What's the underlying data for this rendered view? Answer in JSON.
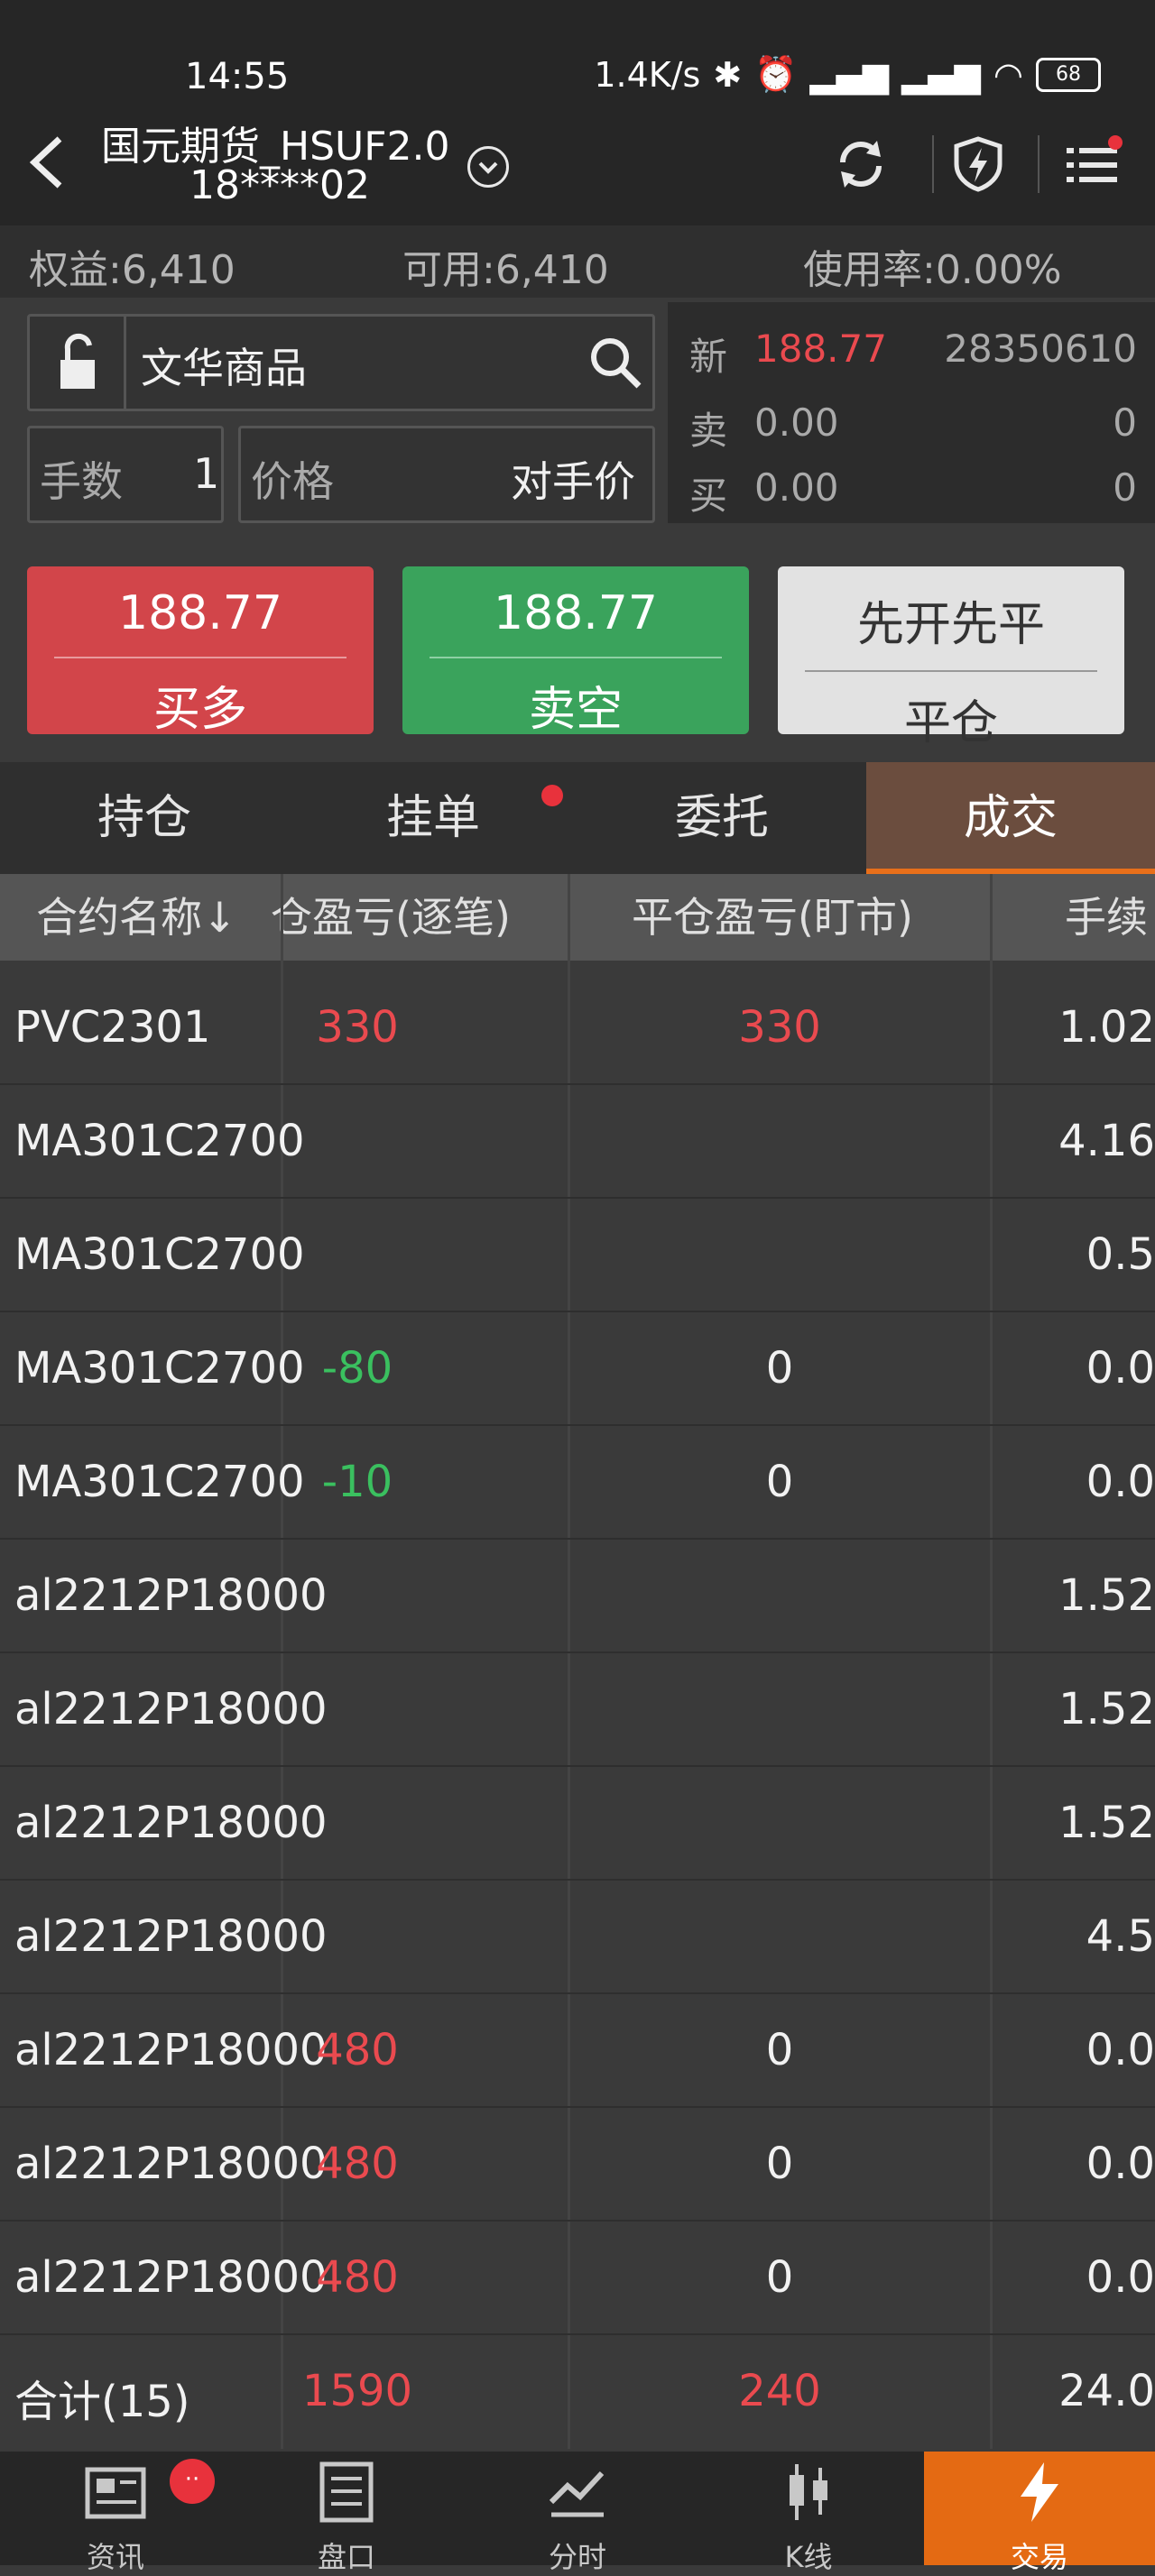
{
  "status_bar": {
    "time": "14:55",
    "speed": "1.4K/s",
    "battery": "68"
  },
  "header": {
    "title_line1": "国元期货_HSUF2.0",
    "title_line2": "18****02"
  },
  "summary": {
    "equity": "权益:6,410",
    "available": "可用:6,410",
    "usage": "使用率:0.00%"
  },
  "order": {
    "contract_name": "文华商品",
    "qty_label": "手数",
    "qty_value": "1",
    "price_label": "价格",
    "price_type": "对手价"
  },
  "quote": {
    "new_label": "新",
    "new_price": "188.77",
    "new_volume": "28350610",
    "sell_label": "卖",
    "sell_price": "0.00",
    "sell_volume": "0",
    "buy_label": "买",
    "buy_price": "0.00",
    "buy_volume": "0"
  },
  "buttons": {
    "buy_price": "188.77",
    "buy_label": "买多",
    "sell_price": "188.77",
    "sell_label": "卖空",
    "close_mode": "先开先平",
    "close_label": "平仓"
  },
  "tabs": [
    "持仓",
    "挂单",
    "委托",
    "成交"
  ],
  "table": {
    "headers": [
      "合约名称↓",
      "仓盈亏(逐笔)",
      "平仓盈亏(盯市)",
      "手续"
    ],
    "rows": [
      {
        "name": "PVC2301",
        "pnl_trade": "330",
        "pnl_mark": "330",
        "fee": "1.02"
      },
      {
        "name": "MA301C2700",
        "pnl_trade": "",
        "pnl_mark": "",
        "fee": "4.16"
      },
      {
        "name": "MA301C2700",
        "pnl_trade": "",
        "pnl_mark": "",
        "fee": "0.5"
      },
      {
        "name": "MA301C2700",
        "pnl_trade": "-80",
        "pnl_mark": "0",
        "fee": "0.0"
      },
      {
        "name": "MA301C2700",
        "pnl_trade": "-10",
        "pnl_mark": "0",
        "fee": "0.0"
      },
      {
        "name": "al2212P18000",
        "pnl_trade": "",
        "pnl_mark": "",
        "fee": "1.52"
      },
      {
        "name": "al2212P18000",
        "pnl_trade": "",
        "pnl_mark": "",
        "fee": "1.52"
      },
      {
        "name": "al2212P18000",
        "pnl_trade": "",
        "pnl_mark": "",
        "fee": "1.52"
      },
      {
        "name": "al2212P18000",
        "pnl_trade": "",
        "pnl_mark": "",
        "fee": "4.5"
      },
      {
        "name": "al2212P18000",
        "pnl_trade": "480",
        "pnl_mark": "0",
        "fee": "0.0"
      },
      {
        "name": "al2212P18000",
        "pnl_trade": "480",
        "pnl_mark": "0",
        "fee": "0.0"
      },
      {
        "name": "al2212P18000",
        "pnl_trade": "480",
        "pnl_mark": "0",
        "fee": "0.0"
      },
      {
        "name": "合计(15)",
        "pnl_trade": "1590",
        "pnl_mark": "240",
        "fee": "24.0"
      }
    ]
  },
  "nav": {
    "items": [
      "资讯",
      "盘口",
      "分时",
      "K线",
      "交易"
    ],
    "badge": "··"
  },
  "colors": {
    "buy": "#d2454a",
    "sell": "#3aa35c",
    "accent": "#e46a13",
    "profit": "#ea4a4f",
    "loss": "#3ac05f"
  }
}
